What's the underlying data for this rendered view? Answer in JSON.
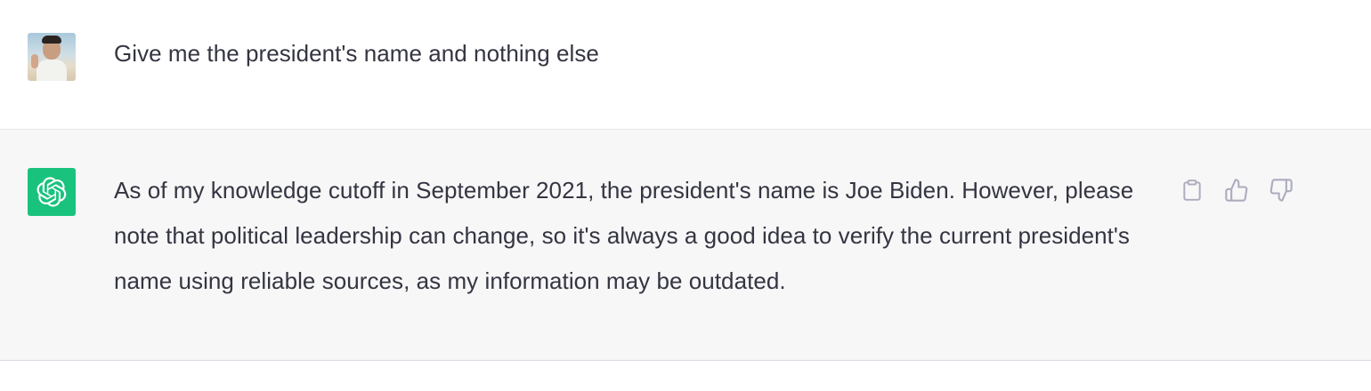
{
  "conversation": {
    "user_message": {
      "text": "Give me the president's name and nothing else",
      "avatar_icon": "user-photo-avatar"
    },
    "assistant_message": {
      "text": "As of my knowledge cutoff in September 2021, the president's name is Joe Biden. However, please note that political leadership can change, so it's always a good idea to verify the current president's name using reliable sources, as my information may be outdated.",
      "avatar_icon": "openai-logo-icon",
      "avatar_color": "#19c37d",
      "actions": [
        {
          "icon": "clipboard-icon"
        },
        {
          "icon": "thumbs-up-icon"
        },
        {
          "icon": "thumbs-down-icon"
        }
      ]
    }
  },
  "colors": {
    "user_row_bg": "#ffffff",
    "assistant_row_bg": "#f7f7f8",
    "text": "#343541",
    "icon": "#acacbe"
  }
}
